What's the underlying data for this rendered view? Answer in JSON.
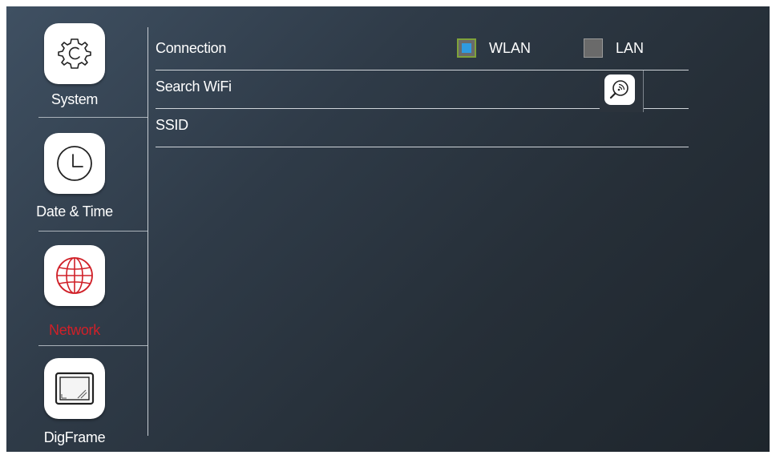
{
  "sidebar": {
    "items": [
      {
        "label": "System",
        "icon": "gear-icon"
      },
      {
        "label": "Date & Time",
        "icon": "clock-icon"
      },
      {
        "label": "Network",
        "icon": "globe-icon",
        "active": true
      },
      {
        "label": "DigFrame",
        "icon": "picture-frame-icon"
      }
    ]
  },
  "network": {
    "connection": {
      "label": "Connection",
      "options": [
        {
          "label": "WLAN",
          "checked": true
        },
        {
          "label": "LAN",
          "checked": false
        }
      ]
    },
    "search_wifi": {
      "label": "Search WiFi",
      "button_icon": "wifi-search-icon"
    },
    "ssid": {
      "label": "SSID",
      "value": ""
    }
  },
  "colors": {
    "active_accent": "#d02028",
    "checkbox_fill": "#2f9be0",
    "checkbox_border": "#7fa23a"
  }
}
